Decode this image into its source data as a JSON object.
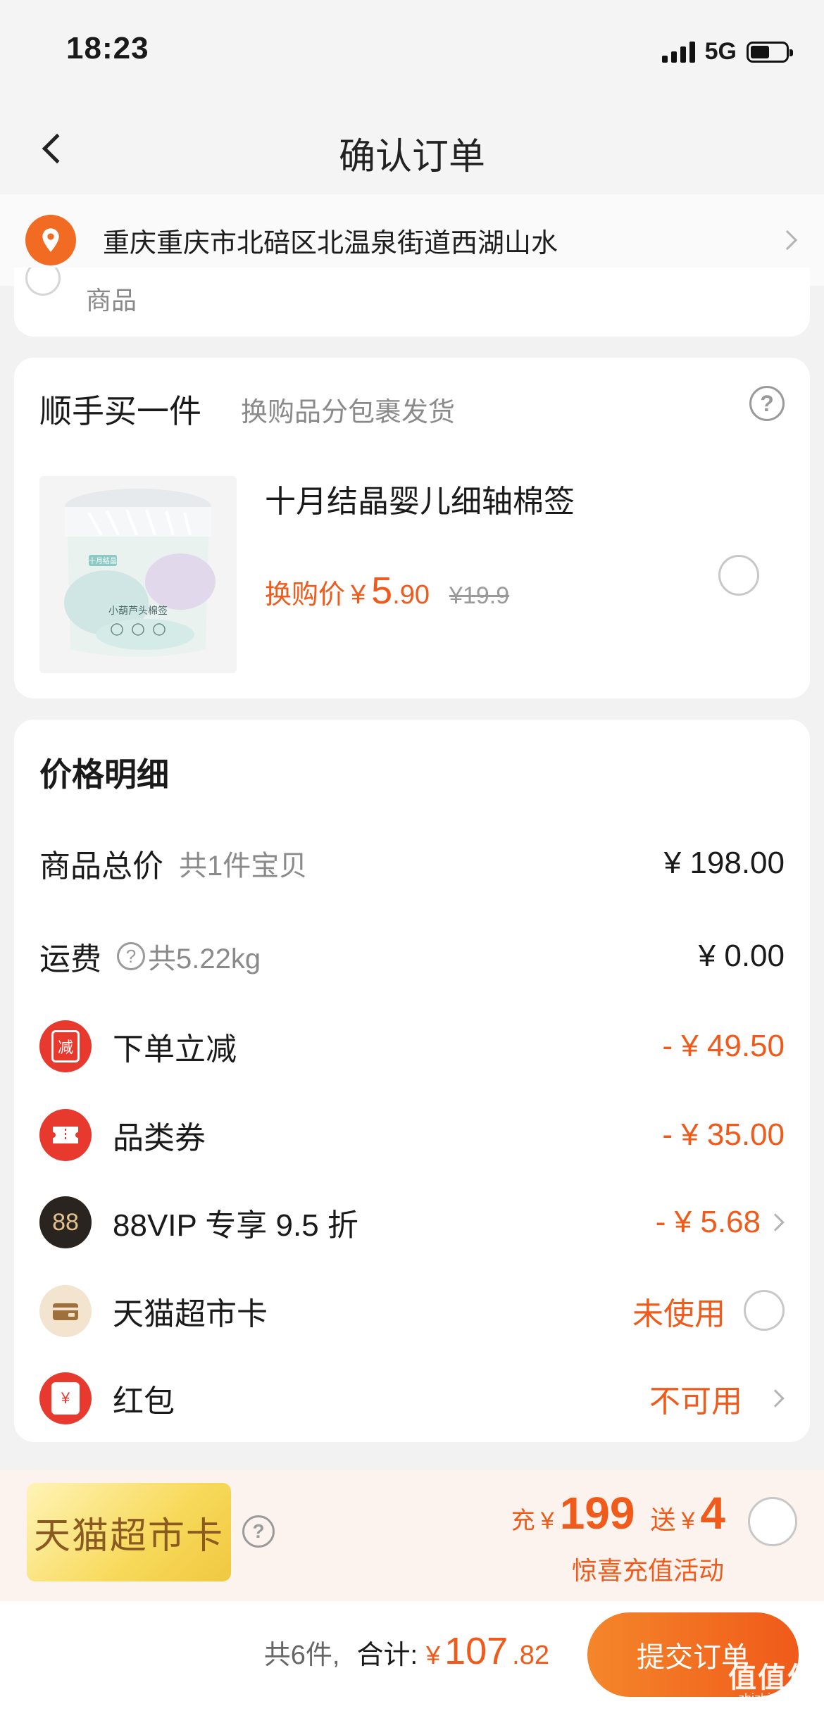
{
  "status_bar": {
    "time": "18:23",
    "network": "5G"
  },
  "nav": {
    "title": "确认订单"
  },
  "address": {
    "text": "重庆重庆市北碚区北温泉街道西湖山水"
  },
  "top_card": {
    "label": "商品"
  },
  "addon": {
    "title": "顺手买一件",
    "subtitle": "换购品分包裹发货",
    "help": "?",
    "product": {
      "name": "十月结晶婴儿细轴棉签",
      "price_label": "换购价",
      "currency": "¥",
      "price_int": "5",
      "price_dec": ".90",
      "original_price": "¥19.9",
      "image_brand": "十月结晶",
      "image_label": "小葫芦头棉签"
    }
  },
  "price_detail": {
    "title": "价格明细",
    "goods_total": {
      "label": "商品总价",
      "sub": "共1件宝贝",
      "value": "¥ 198.00"
    },
    "shipping": {
      "label": "运费",
      "help": "?",
      "sub": "共5.22kg",
      "value": "¥ 0.00"
    },
    "instant_discount": {
      "icon": "减",
      "label": "下单立减",
      "value": "- ¥ 49.50"
    },
    "category_coupon": {
      "label": "品类券",
      "value": "- ¥ 35.00"
    },
    "vip": {
      "icon": "88",
      "label": "88VIP 专享 9.5 折",
      "value": "- ¥ 5.68"
    },
    "market_card": {
      "label": "天猫超市卡",
      "value": "未使用"
    },
    "red_packet": {
      "icon": "¥",
      "label": "红包",
      "value": "不可用"
    }
  },
  "promo": {
    "card_label": "天猫超市卡",
    "help": "?",
    "prefix": "充",
    "currency": "¥",
    "recharge": "199",
    "bonus_word": "送",
    "bonus": "4",
    "subtitle": "惊喜充值活动"
  },
  "footer": {
    "count": "共6件,",
    "total_label": "合计:",
    "currency": "¥",
    "total_int": "107",
    "total_dec": ".82",
    "submit": "提交订单",
    "watermark": "值值值",
    "watermark_sub": "zhizhizhi.com"
  },
  "colors": {
    "accent": "#f05a1a",
    "location_icon": "#f26b22",
    "discount_icon": "#e8392f",
    "vip_icon": "#2a2420"
  }
}
